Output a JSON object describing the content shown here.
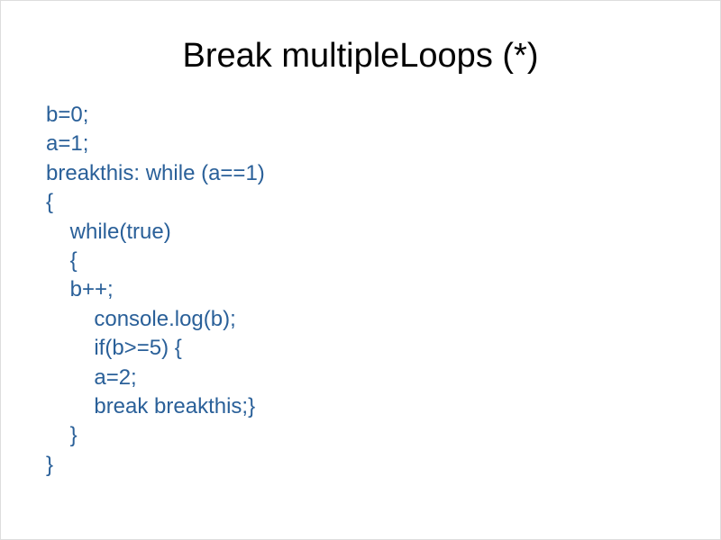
{
  "title": "Break multipleLoops (*)",
  "code": {
    "line1": "b=0;",
    "line2": "a=1;",
    "line3": "breakthis: while (a==1)",
    "line4": "{",
    "line5": "    while(true)",
    "line6": "    {",
    "line7": "    b++;",
    "line8": "        console.log(b);",
    "line9": "        if(b>=5) {",
    "line10": "        a=2;",
    "line11": "        break breakthis;}",
    "line12": "    }",
    "line13": "}"
  }
}
